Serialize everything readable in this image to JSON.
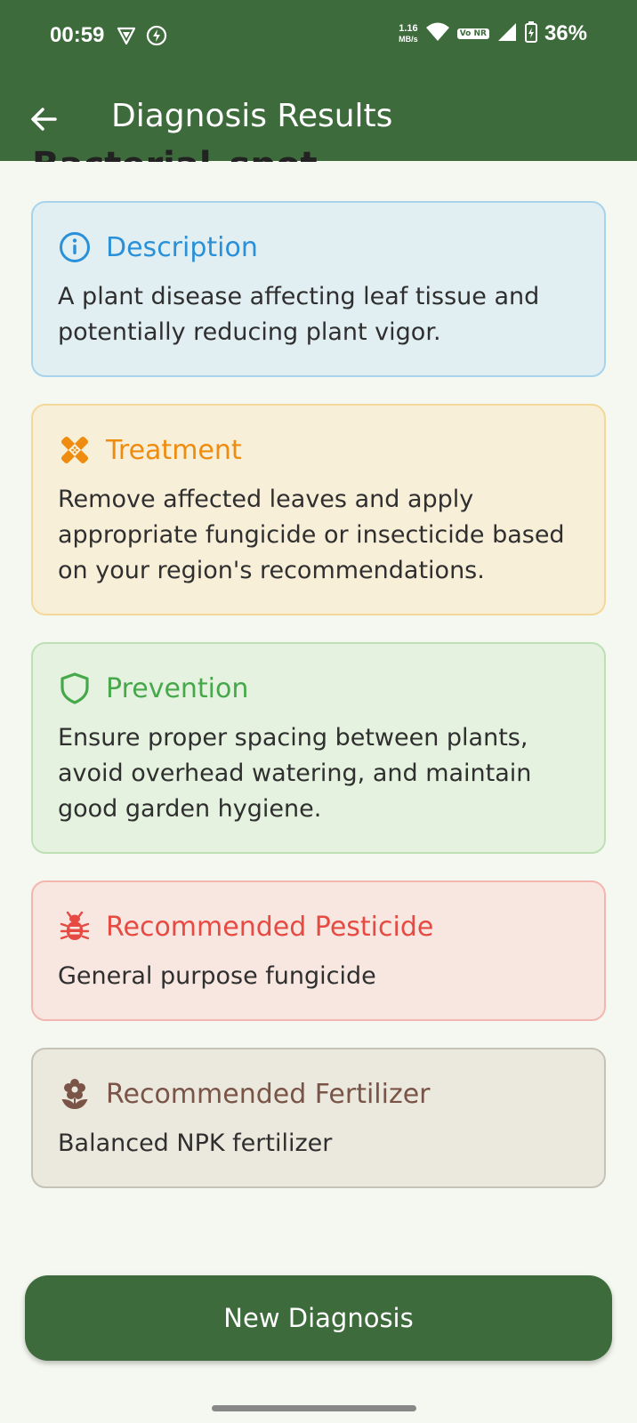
{
  "status_bar": {
    "time": "00:59",
    "net_speed_value": "1.16",
    "net_speed_unit": "MB/s",
    "volte": "Vo NR",
    "battery": "36%"
  },
  "app_bar": {
    "title": "Diagnosis Results"
  },
  "disease_heading": "Bacterial_spot",
  "cards": {
    "description": {
      "title": "Description",
      "body": "A plant disease affecting leaf tissue and potentially reducing plant vigor.",
      "icon": "info-icon"
    },
    "treatment": {
      "title": "Treatment",
      "body": "Remove affected leaves and apply appropriate fungicide or insecticide based on your region's recommendations.",
      "icon": "bandage-icon"
    },
    "prevention": {
      "title": "Prevention",
      "body": "Ensure proper spacing between plants, avoid overhead watering, and maintain good garden hygiene.",
      "icon": "shield-icon"
    },
    "pesticide": {
      "title": "Recommended Pesticide",
      "body": "General purpose fungicide",
      "icon": "bug-icon"
    },
    "fertilizer": {
      "title": "Recommended Fertilizer",
      "body": "Balanced NPK fertilizer",
      "icon": "flower-icon"
    }
  },
  "actions": {
    "new_diagnosis_label": "New Diagnosis"
  },
  "colors": {
    "primary": "#3d6b3b",
    "description": "#2a90d8",
    "treatment": "#ee8c10",
    "prevention": "#46a84a",
    "pesticide": "#e64a43",
    "fertilizer": "#7a5446"
  }
}
